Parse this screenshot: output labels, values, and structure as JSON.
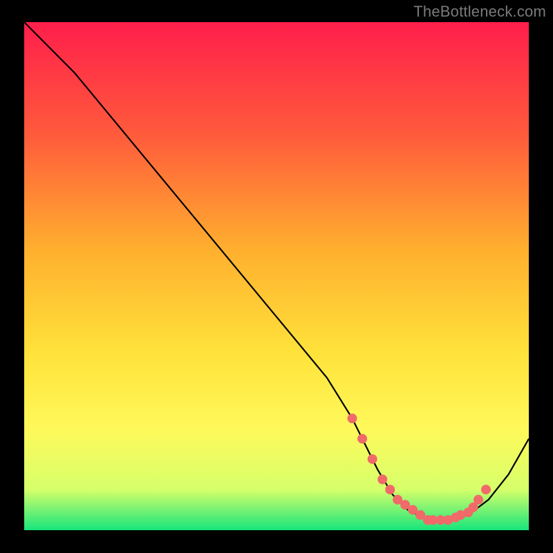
{
  "watermark": "TheBottleneck.com",
  "colors": {
    "frame": "#000000",
    "watermark_text": "#7a7a7a",
    "curve_stroke": "#000000",
    "dot_fill": "#f06a6a",
    "dot_stroke": "#f06a6a",
    "grad_top": "#ff1e4b",
    "grad_mid1": "#ff5a3c",
    "grad_mid2": "#ffb02e",
    "grad_mid3": "#ffe23a",
    "grad_mid4": "#fff95a",
    "grad_band": "#d6ff6a",
    "grad_bottom": "#17e57c"
  },
  "chart_data": {
    "type": "line",
    "title": "",
    "xlabel": "",
    "ylabel": "",
    "xlim": [
      0,
      100
    ],
    "ylim": [
      0,
      100
    ],
    "series": [
      {
        "name": "curve",
        "x": [
          0,
          4,
          10,
          20,
          30,
          40,
          50,
          60,
          65,
          68,
          70,
          73,
          76,
          80,
          84,
          88,
          92,
          96,
          100
        ],
        "y": [
          100,
          96,
          90,
          78,
          66,
          54,
          42,
          30,
          22,
          16,
          12,
          7,
          4,
          2,
          2,
          3,
          6,
          11,
          18
        ]
      }
    ],
    "dots": {
      "name": "trough-dots",
      "x": [
        65,
        67,
        69,
        71,
        72.5,
        74,
        75.5,
        77,
        78.5,
        80,
        81,
        82.5,
        84,
        85.5,
        86.5,
        88,
        89,
        90,
        91.5
      ],
      "y": [
        22,
        18,
        14,
        10,
        8,
        6,
        5,
        4,
        3,
        2,
        2,
        2,
        2,
        2.5,
        3,
        3.5,
        4.5,
        6,
        8
      ]
    }
  }
}
